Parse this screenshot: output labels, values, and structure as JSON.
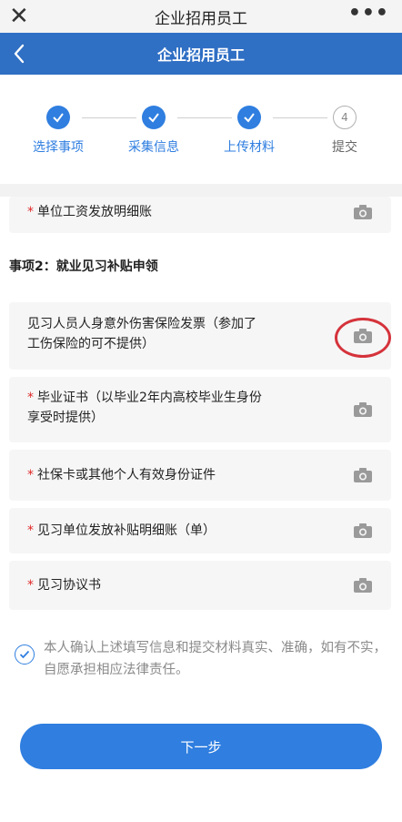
{
  "system_bar": {
    "close_icon": "close-icon",
    "title": "企业招用员工",
    "more_label": "•••"
  },
  "app_bar": {
    "title": "企业招用员工",
    "back_icon": "chevron-left-icon"
  },
  "steps": [
    {
      "label": "选择事项",
      "status": "done"
    },
    {
      "label": "采集信息",
      "status": "done"
    },
    {
      "label": "上传材料",
      "status": "done"
    },
    {
      "label": "提交",
      "status": "pending",
      "number": "4"
    }
  ],
  "items_top": [
    {
      "label": "单位工资发放明细账",
      "required": true
    }
  ],
  "section_title": "事项2：就业见习补贴申领",
  "items": [
    {
      "label": "见习人员人身意外伤害保险发票（参加了工伤保险的可不提供）",
      "label_line1": "见习人员人身意外伤害保险发票（参加了",
      "label_line2": "工伤保险的可不提供）",
      "required": false
    },
    {
      "label_line1": "毕业证书（以毕业2年内高校毕业生身份",
      "label_line2": "享受时提供）",
      "required": true
    },
    {
      "label": "社保卡或其他个人有效身份证件",
      "required": true
    },
    {
      "label": "见习单位发放补贴明细账（单）",
      "required": true
    },
    {
      "label": "见习协议书",
      "required": true
    }
  ],
  "required_mark": "*",
  "agreement": {
    "text": "本人确认上述填写信息和提交材料真实、准确，如有不实，自愿承担相应法律责任。",
    "checked": true
  },
  "next_button": {
    "label": "下一步"
  },
  "colors": {
    "brand": "#2f6fc4",
    "accent": "#2f7ee0",
    "required": "#e02828",
    "highlight_ring": "#d5333b"
  }
}
